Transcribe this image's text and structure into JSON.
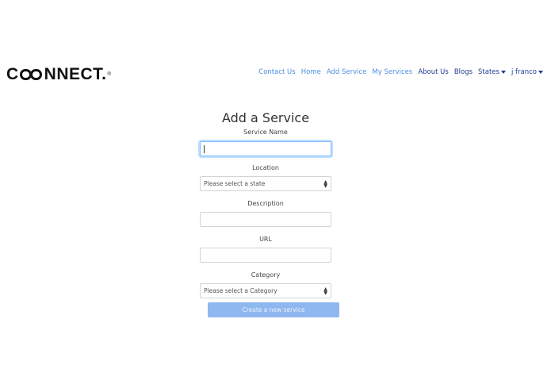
{
  "brand": {
    "name_c": "C",
    "name_rest": "NNECT.",
    "reg": "®"
  },
  "nav": {
    "items": [
      {
        "label": "Contact Us"
      },
      {
        "label": "Home"
      },
      {
        "label": "Add Service"
      },
      {
        "label": "My Services"
      },
      {
        "label": "About Us"
      },
      {
        "label": "Blogs"
      },
      {
        "label": "States"
      },
      {
        "label": "j franco"
      }
    ]
  },
  "form": {
    "title": "Add a Service",
    "service_name": {
      "label": "Service Name",
      "value": ""
    },
    "location": {
      "label": "Location",
      "selected": "Please select a state"
    },
    "description": {
      "label": "Description",
      "value": ""
    },
    "url": {
      "label": "URL",
      "value": ""
    },
    "category": {
      "label": "Category",
      "selected": "Please select a Category"
    },
    "submit_label": "Create a new service"
  },
  "colors": {
    "link": "#4a90e2",
    "link_dark": "#1f3a93",
    "button": "#90b8f0"
  }
}
